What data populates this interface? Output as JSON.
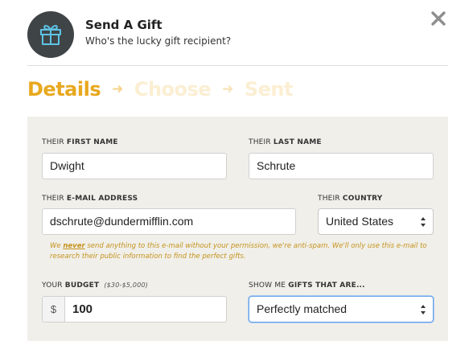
{
  "header": {
    "title": "Send A Gift",
    "subtitle": "Who's the lucky gift recipient?"
  },
  "steps": [
    {
      "label": "Details",
      "state": "active"
    },
    {
      "label": "Choose",
      "state": "inactive"
    },
    {
      "label": "Sent",
      "state": "inactive"
    }
  ],
  "step_separator": "➜",
  "form": {
    "first_name": {
      "label_prefix": "THEIR",
      "label_bold": "FIRST NAME",
      "value": "Dwight"
    },
    "last_name": {
      "label_prefix": "THEIR",
      "label_bold": "LAST NAME",
      "value": "Schrute"
    },
    "email": {
      "label_prefix": "THEIR",
      "label_bold": "E-MAIL ADDRESS",
      "value": "dschrute@dundermifflin.com"
    },
    "country": {
      "label_prefix": "THEIR",
      "label_bold": "COUNTRY",
      "value": "United States"
    },
    "notice": {
      "pre": "We ",
      "never": "never",
      "post": " send anything to this e-mail without your permission, we're anti-spam. We'll only use this e-mail to research their public information to find the perfect gifts."
    },
    "budget": {
      "label_prefix": "YOUR",
      "label_bold": "BUDGET",
      "hint": "($30-$5,000)",
      "currency": "$",
      "value": "100"
    },
    "gift_type": {
      "label_prefix": "SHOW ME",
      "label_bold": "GIFTS THAT ARE...",
      "value": "Perfectly matched"
    }
  },
  "colors": {
    "accent": "#e8a81f",
    "inactive_step": "#fbeed2",
    "form_bg": "#f0efea",
    "icon_circle": "#3f4447",
    "gift_icon": "#5ec3e6",
    "focus_border": "#6aa2e8"
  },
  "icons": {
    "gift": "gift-icon",
    "close": "close-icon"
  }
}
